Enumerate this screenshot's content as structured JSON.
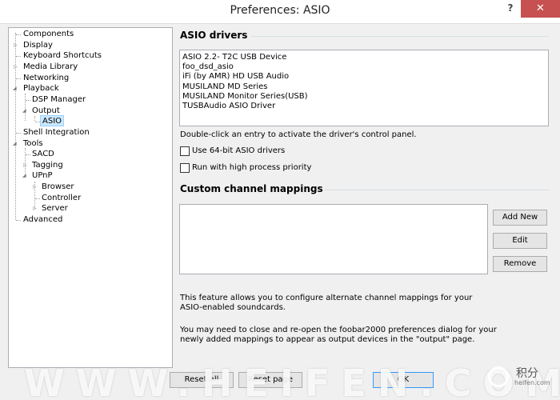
{
  "window": {
    "title": "Preferences: ASIO",
    "help_label": "?",
    "close_label": "✕"
  },
  "tree": [
    {
      "label": "Components"
    },
    {
      "label": "Display"
    },
    {
      "label": "Keyboard Shortcuts"
    },
    {
      "label": "Media Library"
    },
    {
      "label": "Networking"
    },
    {
      "label": "Playback"
    },
    {
      "label": "DSP Manager"
    },
    {
      "label": "Output"
    },
    {
      "label": "ASIO",
      "selected": true
    },
    {
      "label": "Shell Integration"
    },
    {
      "label": "Tools"
    },
    {
      "label": "SACD"
    },
    {
      "label": "Tagging"
    },
    {
      "label": "UPnP"
    },
    {
      "label": "Browser"
    },
    {
      "label": "Controller"
    },
    {
      "label": "Server"
    },
    {
      "label": "Advanced"
    }
  ],
  "asio_drivers": {
    "heading": "ASIO drivers",
    "items": [
      "ASIO 2.2- T2C USB Device",
      "foo_dsd_asio",
      "iFi (by AMR) HD USB Audio",
      "MUSILAND MD Series",
      "MUSILAND Monitor Series(USB)",
      "TUSBAudio ASIO Driver"
    ],
    "hint": "Double-click an entry to activate the driver's control panel.",
    "use_64bit_label": "Use 64-bit ASIO drivers",
    "use_64bit_checked": false,
    "high_priority_label": "Run with high process priority",
    "high_priority_checked": false
  },
  "custom_mappings": {
    "heading": "Custom channel mappings",
    "add_new_label": "Add New",
    "edit_label": "Edit",
    "remove_label": "Remove",
    "description1": "This feature allows you to configure alternate channel mappings for your ASIO-enabled soundcards.",
    "description2": "You may need to close and re-open the foobar2000 preferences dialog for your newly added mappings to appear as output devices in the \"output\" page."
  },
  "footer": {
    "reset_all_label": "Reset all",
    "reset_page_label": "Reset page",
    "ok_label": "OK"
  },
  "watermark": {
    "text": "WWW.HEIFEN.COM",
    "brand": "积分",
    "sub": "heifen.com"
  }
}
